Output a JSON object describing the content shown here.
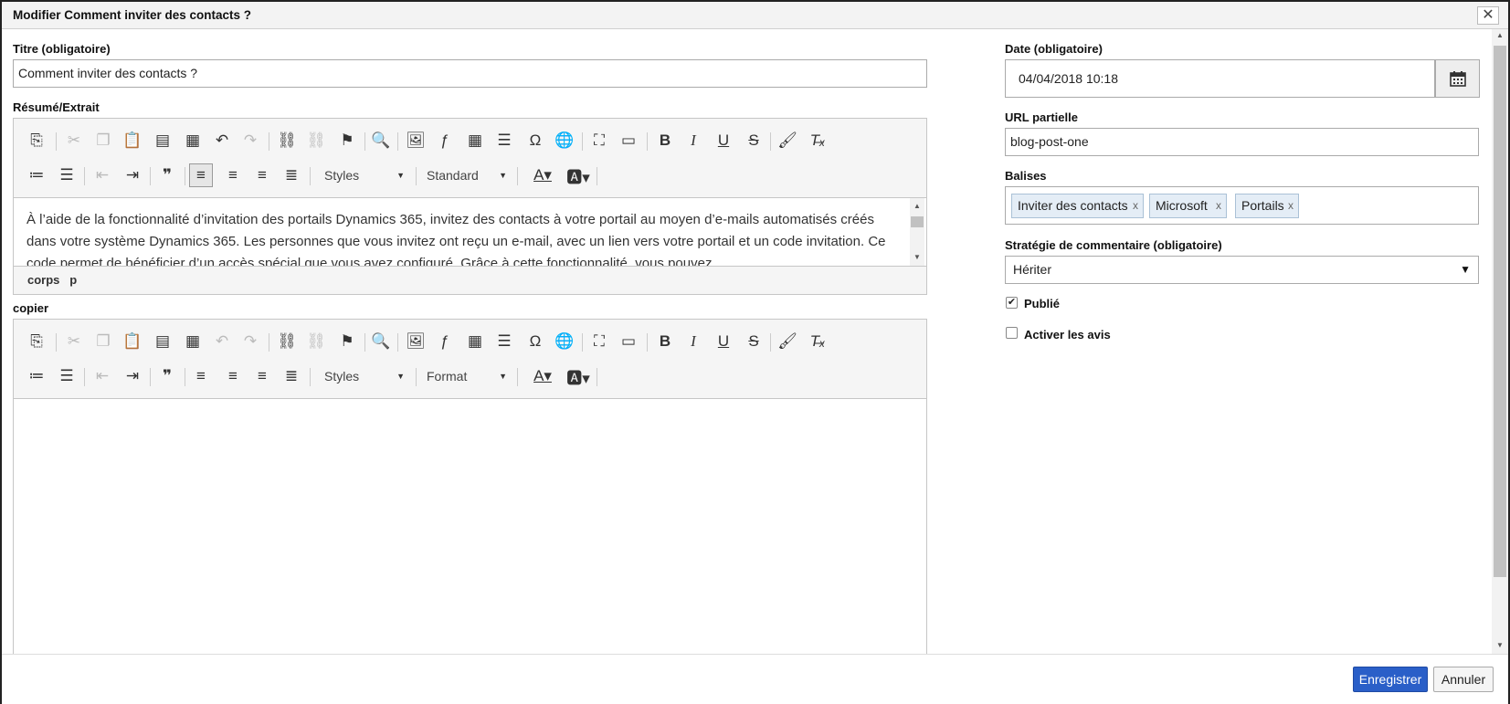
{
  "dialog": {
    "title": "Modifier Comment inviter des contacts ?",
    "close_glyph": "✕"
  },
  "form": {
    "title_label": "Titre (obligatoire)",
    "title_value": "Comment inviter des contacts ?",
    "summary_label": "Résumé/Extrait",
    "summary_text": "À l’aide de la fonctionnalité d’invitation des portails Dynamics 365, invitez des contacts à votre portail au moyen d’e-mails automatisés créés dans votre système Dynamics 365. Les personnes que vous invitez ont reçu un e-mail, avec un lien vers votre portail et un code invitation. Ce code permet de bénéficier d’un accès spécial que vous avez configuré. Grâce à cette fonctionnalité, vous pouvez",
    "summary_path": [
      "corps",
      "p"
    ],
    "copy_label": "copier",
    "date_label": "Date (obligatoire)",
    "date_value": "04/04/2018 10:18",
    "url_label": "URL partielle",
    "url_value": "blog-post-one",
    "tags_label": "Balises",
    "tags": [
      "Inviter des contacts",
      "Microsoft",
      "Portails"
    ],
    "tag_remove_glyph": "x",
    "comment_label": "Stratégie de commentaire (obligatoire)",
    "comment_value": "Hériter",
    "published_label": "Publié",
    "published_checked": true,
    "reviews_label": "Activer les avis",
    "reviews_checked": false
  },
  "editor1": {
    "styles": "Styles",
    "format": "Standard"
  },
  "editor2": {
    "styles": "Styles",
    "format": "Format"
  },
  "buttons": {
    "save": "Enregistrer",
    "cancel": "Annuler"
  },
  "colors": {
    "primary": "#2a5fc8",
    "tag_bg": "#e4edf6"
  }
}
